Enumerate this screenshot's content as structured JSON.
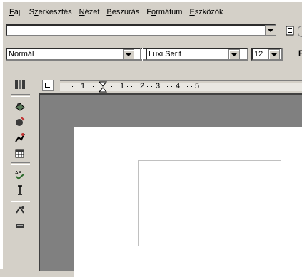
{
  "menubar": {
    "items": [
      {
        "pre": "",
        "accel": "F",
        "post": "ájl"
      },
      {
        "pre": "S",
        "accel": "z",
        "post": "erkesztés"
      },
      {
        "pre": "",
        "accel": "N",
        "post": "ézet"
      },
      {
        "pre": "",
        "accel": "B",
        "post": "eszúrás"
      },
      {
        "pre": "F",
        "accel": "o",
        "post": "rmátum"
      },
      {
        "pre": "",
        "accel": "E",
        "post": "szközök"
      }
    ]
  },
  "command_row": {
    "field_value": ""
  },
  "format_row": {
    "style": "Normál",
    "font": "Luxi Serif",
    "size": "12",
    "trailing": "F"
  },
  "ruler": {
    "numbers": [
      "1",
      "1",
      "2",
      "3",
      "4",
      "5"
    ]
  },
  "icons": {
    "toolbar": [
      "text-icon"
    ],
    "left": [
      "columns-icon",
      "draw-icon",
      "insert-icon",
      "autoshape-icon",
      "table-icon",
      "spellcheck-icon",
      "cursor-icon",
      "function-icon",
      "navigator-icon"
    ]
  }
}
